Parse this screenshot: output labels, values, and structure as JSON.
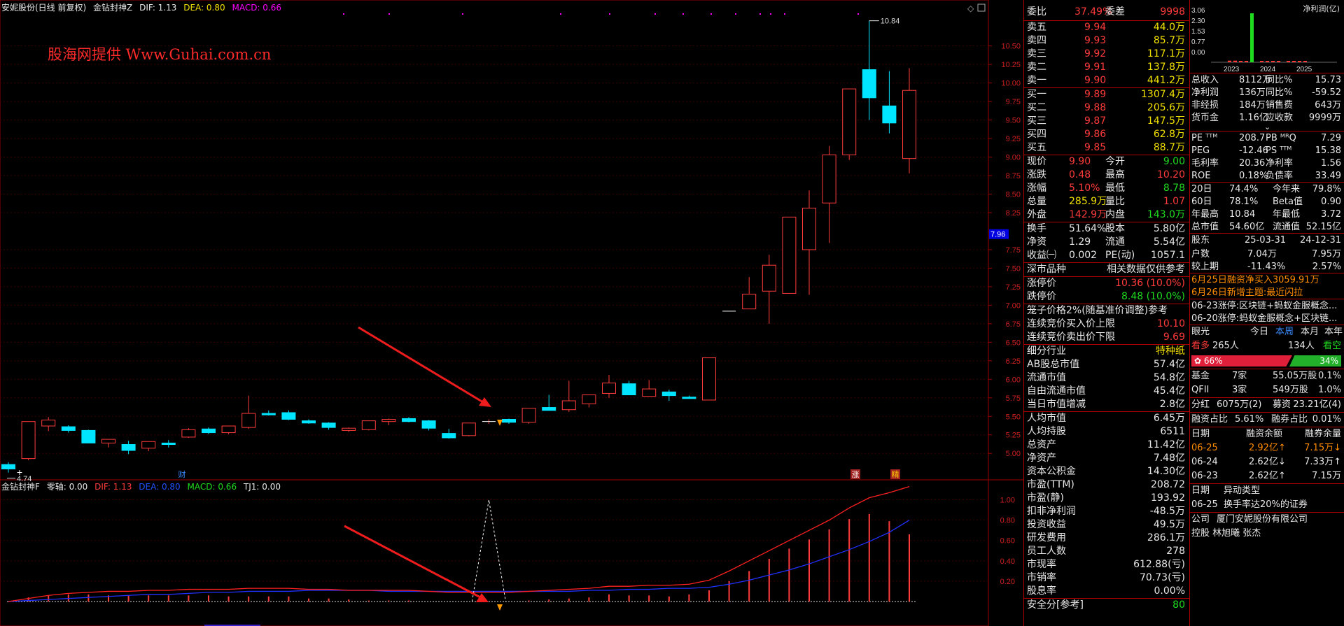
{
  "chart_header": {
    "title": "安妮股份(日线 前复权)",
    "indicator": "金钻封神Z",
    "dif": "DIF: 1.13",
    "dea": "DEA: 0.80",
    "macd": "MACD: 0.66"
  },
  "sub_header": {
    "title": "金钻封神F",
    "zero": "零轴: 0.00",
    "dif": "DIF: 1.13",
    "dea": "DEA: 0.80",
    "macd": "MACD: 0.66",
    "tj1": "TJ1: 0.00"
  },
  "watermark": "股海网提供  Www.Guhai.com.cn",
  "price_axis": [
    "10.50",
    "10.25",
    "10.00",
    "9.75",
    "9.50",
    "9.25",
    "9.00",
    "8.75",
    "8.50",
    "8.25",
    "7.75",
    "7.50",
    "7.25",
    "7.00",
    "6.75",
    "6.50",
    "6.25",
    "6.00",
    "5.75",
    "5.50",
    "5.25",
    "5.00"
  ],
  "current_price_tag": "7.96",
  "sub_axis": [
    "1.00",
    "0.80",
    "0.60",
    "0.40",
    "0.20"
  ],
  "high_label": "10.84",
  "low_label": "4.74",
  "event_labels": {
    "fin": "财",
    "zhang": "涨",
    "jing": "精"
  },
  "colors": {
    "up": "#ff3b3b",
    "down": "#00e5ff",
    "dif": "#ff2020",
    "dea": "#2030ff",
    "grid": "#3a0000",
    "axis": "#a00000"
  },
  "chart_data": {
    "type": "candlestick",
    "candles": [
      [
        4.85,
        4.88,
        4.74,
        4.79
      ],
      [
        4.93,
        5.43,
        4.91,
        5.43
      ],
      [
        5.37,
        5.49,
        5.3,
        5.45
      ],
      [
        5.36,
        5.38,
        5.28,
        5.31
      ],
      [
        5.31,
        5.32,
        5.14,
        5.14
      ],
      [
        5.14,
        5.19,
        5.08,
        5.19
      ],
      [
        5.12,
        5.17,
        4.99,
        5.04
      ],
      [
        5.07,
        5.16,
        5.03,
        5.16
      ],
      [
        5.14,
        5.18,
        5.08,
        5.12
      ],
      [
        5.22,
        5.34,
        5.21,
        5.32
      ],
      [
        5.33,
        5.35,
        5.26,
        5.28
      ],
      [
        5.28,
        5.37,
        5.26,
        5.37
      ],
      [
        5.35,
        5.78,
        5.33,
        5.54
      ],
      [
        5.54,
        5.58,
        5.51,
        5.52
      ],
      [
        5.55,
        5.58,
        5.45,
        5.46
      ],
      [
        5.44,
        5.46,
        5.4,
        5.41
      ],
      [
        5.41,
        5.42,
        5.32,
        5.35
      ],
      [
        5.31,
        5.35,
        5.29,
        5.34
      ],
      [
        5.32,
        5.44,
        5.31,
        5.44
      ],
      [
        5.43,
        5.47,
        5.38,
        5.46
      ],
      [
        5.47,
        5.49,
        5.42,
        5.43
      ],
      [
        5.44,
        5.45,
        5.31,
        5.34
      ],
      [
        5.27,
        5.33,
        5.2,
        5.21
      ],
      [
        5.24,
        5.41,
        5.23,
        5.41
      ],
      [
        5.43,
        5.46,
        5.4,
        5.43
      ],
      [
        5.46,
        5.47,
        5.4,
        5.42
      ],
      [
        5.42,
        5.61,
        5.4,
        5.61
      ],
      [
        5.62,
        5.79,
        5.58,
        5.58
      ],
      [
        5.59,
        5.98,
        5.56,
        5.71
      ],
      [
        5.67,
        5.79,
        5.62,
        5.79
      ],
      [
        5.81,
        6.06,
        5.75,
        5.95
      ],
      [
        5.94,
        5.98,
        5.79,
        5.79
      ],
      [
        5.77,
        5.99,
        5.77,
        5.87
      ],
      [
        5.83,
        5.86,
        5.71,
        5.78
      ],
      [
        5.76,
        5.78,
        5.74,
        5.74
      ],
      [
        5.72,
        6.29,
        5.72,
        6.29
      ],
      [
        6.92,
        6.92,
        6.92,
        6.92
      ],
      [
        6.95,
        7.38,
        6.95,
        7.15
      ],
      [
        7.19,
        7.68,
        6.75,
        7.54
      ],
      [
        7.16,
        7.93,
        7.16,
        8.19
      ],
      [
        7.75,
        8.55,
        7.14,
        8.31
      ],
      [
        8.38,
        9.15,
        7.84,
        9.03
      ],
      [
        9.03,
        9.82,
        8.96,
        9.92
      ],
      [
        10.18,
        10.84,
        9.5,
        9.8
      ],
      [
        9.69,
        10.16,
        9.32,
        9.46
      ],
      [
        8.98,
        10.2,
        8.78,
        9.9
      ]
    ],
    "dif": [
      0.0,
      0.03,
      0.06,
      0.08,
      0.09,
      0.1,
      0.1,
      0.11,
      0.11,
      0.12,
      0.12,
      0.12,
      0.13,
      0.13,
      0.13,
      0.12,
      0.12,
      0.11,
      0.11,
      0.11,
      0.11,
      0.1,
      0.09,
      0.09,
      0.09,
      0.09,
      0.1,
      0.11,
      0.12,
      0.13,
      0.15,
      0.15,
      0.16,
      0.16,
      0.17,
      0.21,
      0.3,
      0.4,
      0.5,
      0.6,
      0.7,
      0.8,
      0.92,
      1.02,
      1.07,
      1.13
    ],
    "dea": [
      0.0,
      0.01,
      0.02,
      0.03,
      0.04,
      0.05,
      0.06,
      0.07,
      0.07,
      0.08,
      0.09,
      0.09,
      0.1,
      0.1,
      0.1,
      0.11,
      0.11,
      0.11,
      0.11,
      0.1,
      0.1,
      0.1,
      0.1,
      0.1,
      0.1,
      0.1,
      0.1,
      0.1,
      0.1,
      0.11,
      0.11,
      0.12,
      0.12,
      0.13,
      0.13,
      0.14,
      0.17,
      0.21,
      0.26,
      0.31,
      0.37,
      0.44,
      0.51,
      0.59,
      0.68,
      0.8
    ],
    "macd": [
      0.0,
      0.04,
      0.06,
      0.07,
      0.07,
      0.06,
      0.06,
      0.06,
      0.06,
      0.06,
      0.06,
      0.05,
      0.05,
      0.05,
      0.05,
      0.03,
      0.03,
      0.02,
      0.01,
      0.01,
      0.01,
      0.0,
      0.0,
      0.0,
      0.0,
      0.0,
      0.01,
      0.02,
      0.03,
      0.04,
      0.07,
      0.06,
      0.06,
      0.05,
      0.07,
      0.11,
      0.2,
      0.3,
      0.42,
      0.52,
      0.61,
      0.71,
      0.81,
      0.86,
      0.79,
      0.66
    ],
    "signal_peak": 1.0,
    "ylim_price": [
      4.7,
      10.95
    ],
    "ylim_sub": [
      0,
      1.1
    ]
  },
  "quote": {
    "weibi": {
      "label": "委比",
      "value": "37.49%",
      "label2": "委差",
      "value2": "9998"
    },
    "sells": [
      {
        "label": "卖五",
        "price": "9.94",
        "vol": "44.0万"
      },
      {
        "label": "卖四",
        "price": "9.93",
        "vol": "85.7万"
      },
      {
        "label": "卖三",
        "price": "9.92",
        "vol": "117.1万"
      },
      {
        "label": "卖二",
        "price": "9.91",
        "vol": "137.8万"
      },
      {
        "label": "卖一",
        "price": "9.90",
        "vol": "441.2万"
      }
    ],
    "buys": [
      {
        "label": "买一",
        "price": "9.89",
        "vol": "1307.4万"
      },
      {
        "label": "买二",
        "price": "9.88",
        "vol": "205.6万"
      },
      {
        "label": "买三",
        "price": "9.87",
        "vol": "147.5万"
      },
      {
        "label": "买四",
        "price": "9.86",
        "vol": "62.8万"
      },
      {
        "label": "买五",
        "price": "9.85",
        "vol": "88.7万"
      }
    ],
    "stats": [
      {
        "l1": "现价",
        "v1": "9.90",
        "l2": "今开",
        "v2": "9.00"
      },
      {
        "l1": "涨跌",
        "v1": "0.48",
        "l2": "最高",
        "v2": "10.20"
      },
      {
        "l1": "涨幅",
        "v1": "5.10%",
        "l2": "最低",
        "v2": "8.78"
      },
      {
        "l1": "总量",
        "v1": "285.9万",
        "l2": "量比",
        "v2": "1.07"
      },
      {
        "l1": "外盘",
        "v1": "142.9万",
        "l2": "内盘",
        "v2": "143.0万"
      }
    ],
    "stats2": [
      {
        "l1": "换手",
        "v1": "51.64%",
        "l2": "股本",
        "v2": "5.80亿"
      },
      {
        "l1": "净资",
        "v1": "1.29",
        "l2": "流通",
        "v2": "5.54亿"
      },
      {
        "l1": "收益㈠",
        "v1": "0.002",
        "l2": "PE(动)",
        "v2": "1057.1"
      }
    ],
    "market": {
      "label": "深市品种",
      "note": "相关数据仅供参考"
    },
    "limits": [
      {
        "label": "涨停价",
        "value": "10.36 (10.0%)"
      },
      {
        "label": "跌停价",
        "value": "8.48 (10.0%)"
      }
    ],
    "cage": {
      "label": "笼子价格2%(随基准价调整)参考"
    },
    "auction": [
      {
        "label": "连续竞价买入价上限",
        "value": "10.10"
      },
      {
        "label": "连续竞价卖出价下限",
        "value": "9.69"
      }
    ],
    "industry": {
      "label": "细分行业",
      "value": "特种纸"
    },
    "fund": [
      {
        "label": "AB股总市值",
        "value": "57.4亿"
      },
      {
        "label": "流通市值",
        "value": "54.8亿"
      },
      {
        "label": "自由流通市值",
        "value": "45.4亿"
      },
      {
        "label": "当日市值增减",
        "value": "2.8亿"
      },
      {
        "label": "人均市值",
        "value": "6.45万"
      },
      {
        "label": "人均持股",
        "value": "6511"
      },
      {
        "label": "总资产",
        "value": "11.42亿"
      },
      {
        "label": "净资产",
        "value": "7.48亿"
      },
      {
        "label": "资本公积金",
        "value": "14.30亿"
      },
      {
        "label": "市盈(TTM)",
        "value": "208.72"
      },
      {
        "label": "市盈(静)",
        "value": "193.92"
      },
      {
        "label": "扣非净利润",
        "value": "-48.5万"
      },
      {
        "label": "投资收益",
        "value": "49.5万"
      },
      {
        "label": "研发费用",
        "value": "286.1万"
      },
      {
        "label": "员工人数",
        "value": "278"
      },
      {
        "label": "市现率",
        "value": "612.88(亏)"
      },
      {
        "label": "市销率",
        "value": "70.73(亏)"
      },
      {
        "label": "股息率",
        "value": "0.00%"
      }
    ],
    "safety": {
      "label": "安全分[参考]",
      "value": "80"
    }
  },
  "f10": {
    "mini_chart": {
      "title": "净利润(亿)",
      "yticks": [
        "3.06",
        "2.30",
        "1.53",
        "0.77",
        "0.00"
      ],
      "years": [
        "2023",
        "2024",
        "2025"
      ],
      "chart_data": {
        "type": "bar",
        "values": [
          0.1,
          0.1,
          0.05,
          0.08,
          3.06,
          0.02,
          0.06,
          0.06,
          0.05,
          0.05,
          0.04,
          0.04,
          0.05
        ]
      }
    },
    "fin": [
      {
        "l1": "总收入",
        "v1": "8112万",
        "l2": "同比%",
        "v2": "15.73"
      },
      {
        "l1": "净利润",
        "v1": "136万",
        "l2": "同比%",
        "v2": "-59.52"
      },
      {
        "l1": "非经损",
        "v1": "184万",
        "l2": "销售费",
        "v2": "643万"
      },
      {
        "l1": "货币金",
        "v1": "1.16亿",
        "l2": "应收款",
        "v2": "9999万"
      }
    ],
    "val": [
      {
        "l1": "PE ᵀᵀᴹ",
        "v1": "208.7",
        "l2": "PB ᴹᴿQ",
        "v2": "7.29"
      },
      {
        "l1": "PEG",
        "v1": "-12.46",
        "l2": "PS ᵀᵀᴹ",
        "v2": "15.38"
      },
      {
        "l1": "毛利率",
        "v1": "20.36",
        "l2": "净利率",
        "v2": "1.56"
      },
      {
        "l1": "ROE",
        "v1": "0.18%",
        "l2": "负债率",
        "v2": "33.49"
      }
    ],
    "perf": [
      {
        "l1": "20日",
        "v1": "74.4%",
        "l2": "今年来",
        "v2": "79.8%"
      },
      {
        "l1": "60日",
        "v1": "78.1%",
        "l2": "Beta值",
        "v2": "0.90"
      },
      {
        "l1": "年最高",
        "v1": "10.84",
        "l2": "年最低",
        "v2": "3.72"
      },
      {
        "l1": "总市值",
        "v1": "54.60亿",
        "l2": "流通值",
        "v2": "52.15亿"
      }
    ],
    "holders": {
      "label": "股东",
      "d1": "25-03-31",
      "d2": "24-12-31",
      "rows": [
        {
          "l": "户数",
          "v1": "7.04万",
          "v2": "7.95万"
        },
        {
          "l": "较上期",
          "v1": "-11.43%",
          "v2": "2.57%"
        }
      ]
    },
    "news": [
      "6月25日融资净买入3059.91万",
      "6月26日新增主题:最近闪拉"
    ],
    "limit_up": [
      "06-23涨停:区块链+蚂蚁金服概念...",
      "06-20涨停:蚂蚁金服概念+区块链..."
    ],
    "view": {
      "label": "眼光",
      "tabs": [
        "今日",
        "本周",
        "本月",
        "本年"
      ],
      "bull": "看多",
      "bull_count": "265人",
      "bear_count": "134人",
      "bear": "看空",
      "bull_pct": "66%",
      "bear_pct": "34%"
    },
    "inst": [
      {
        "l": "基金",
        "v1": "7家",
        "v2": "55.05万股",
        "v3": "0.1%"
      },
      {
        "l": "QFII",
        "v1": "3家",
        "v2": "549万股",
        "v3": "1.0%"
      }
    ],
    "div": {
      "l1": "分红",
      "v1": "6075万(2)",
      "l2": "募资",
      "v2": "23.21亿(4)"
    },
    "margin_ratio": {
      "l1": "融资占比",
      "v1": "5.61%",
      "l2": "融券占比",
      "v2": "0.01%"
    },
    "margin": {
      "h": [
        "日期",
        "融资余额",
        "融券余量"
      ],
      "rows": [
        [
          "06-25",
          "2.92亿↑",
          "7.15万↓"
        ],
        [
          "06-24",
          "2.62亿↓",
          "7.33万↑"
        ],
        [
          "06-23",
          "2.62亿↑",
          "7.15万"
        ]
      ]
    },
    "abnormal": {
      "h": [
        "日期",
        "异动类型"
      ],
      "rows": [
        [
          "06-25",
          "换手率达20%的证券"
        ]
      ]
    },
    "company": {
      "label": "公司",
      "value": "厦门安妮股份有限公司"
    },
    "bottom": "控股  林旭曦 张杰"
  }
}
